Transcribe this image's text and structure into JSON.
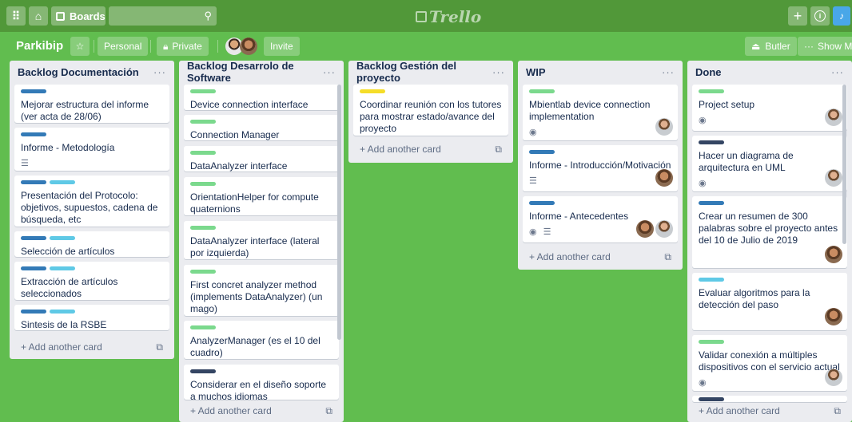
{
  "topbar": {
    "apps_icon": "grid-icon",
    "home_icon": "home-icon",
    "boards_label": "Boards",
    "search_icon": "search-icon",
    "logo_text": "Trello",
    "plus_icon": "plus-icon",
    "info_icon": "info-icon",
    "bell_icon": "bell-icon"
  },
  "board": {
    "title": "Parkibip",
    "star_icon": "star-icon",
    "team_label": "Personal",
    "privacy_label": "Private",
    "invite_label": "Invite",
    "butler_label": "Butler",
    "show_menu_label": "Show Me"
  },
  "colors": {
    "green": "#61bd4f",
    "blue": "#0079bf",
    "sky": "#00c2e0",
    "yellow": "#f2d600",
    "navy": "#344563",
    "label_green": "#7bd98d",
    "label_blue": "#337ab7",
    "label_sky": "#5fc9e6",
    "label_yellow": "#f5dd29",
    "label_navy": "#344563"
  },
  "add_card_label": "+ Add another card",
  "lists": [
    {
      "title": "Backlog Documentación",
      "cards": [
        {
          "text": "Mejorar estructura del informe (ver acta de 28/06)"
        },
        {
          "text": "Informe - Metodología",
          "badge": "description-icon"
        },
        {
          "text": "Presentación del Protocolo: objetivos, supuestos, cadena de búsqueda, etc"
        },
        {
          "text": "Selección de artículos"
        },
        {
          "text": "Extracción de artículos seleccionados"
        },
        {
          "text": "Sintesis de la RSBE"
        }
      ]
    },
    {
      "title": "Backlog Desarrolo de Software",
      "cards": [
        {
          "text": "Device connection interface"
        },
        {
          "text": "Connection Manager"
        },
        {
          "text": "DataAnalyzer interface"
        },
        {
          "text": "OrientationHelper for compute quaternions"
        },
        {
          "text": "DataAnalyzer interface (lateral por izquierda)"
        },
        {
          "text": "First concret analyzer method (implements DataAnalyzer) (un mago)"
        },
        {
          "text": "AnalyzerManager (es el 10 del cuadro)"
        },
        {
          "text": "Considerar en el diseño soporte a muchos idiomas"
        }
      ]
    },
    {
      "title": "Backlog Gestión del proyecto",
      "cards": [
        {
          "text": "Coordinar reunión con los tutores para mostrar estado/avance del proyecto"
        }
      ]
    },
    {
      "title": "WIP",
      "cards": [
        {
          "text": "Mbientlab device connection implementation",
          "badge": "watch-icon"
        },
        {
          "text": "Informe - Introducción/Motivación",
          "badge": "description-icon"
        },
        {
          "text": "Informe - Antecedentes",
          "badge": "watch-icon"
        }
      ]
    },
    {
      "title": "Done",
      "cards": [
        {
          "text": "Project setup",
          "badge": "watch-icon"
        },
        {
          "text": "Hacer un diagrama de arquitectura en UML",
          "badge": "watch-icon"
        },
        {
          "text": "Crear un resumen de 300 palabras sobre el proyecto antes del 10 de Julio de 2019"
        },
        {
          "text": "Evaluar algoritmos para la detección del paso"
        },
        {
          "text": "Validar conexión a múltiples dispositivos con el servicio actual",
          "badge": "watch-icon"
        }
      ]
    }
  ]
}
